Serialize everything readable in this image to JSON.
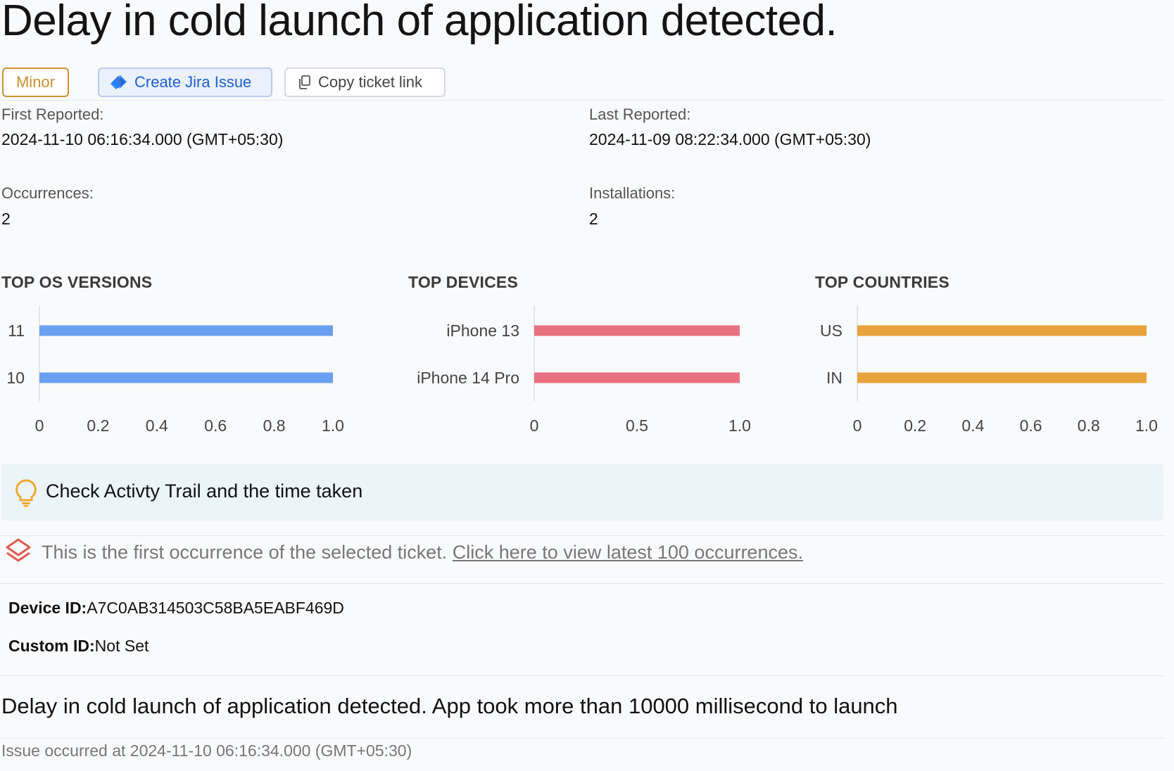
{
  "issue": {
    "title": "Delay in cold launch of application detected.",
    "severity_label": "Minor",
    "jira_button_label": "Create Jira Issue",
    "copy_button_label": "Copy ticket link"
  },
  "stats": {
    "first_reported_label": "First Reported:",
    "first_reported_value": "2024-11-10 06:16:34.000 (GMT+05:30)",
    "last_reported_label": "Last Reported:",
    "last_reported_value": "2024-11-09 08:22:34.000 (GMT+05:30)",
    "occurrences_label": "Occurrences:",
    "occurrences_value": "2",
    "installations_label": "Installations:",
    "installations_value": "2"
  },
  "chart_data": [
    {
      "type": "bar",
      "orientation": "horizontal",
      "title": "TOP OS VERSIONS",
      "categories": [
        "11",
        "10"
      ],
      "values": [
        1.0,
        1.0
      ],
      "xlim": [
        0,
        1.0
      ],
      "xticks": [
        "0",
        "0.2",
        "0.4",
        "0.6",
        "0.8",
        "1.0"
      ],
      "color": "#6b9ff0"
    },
    {
      "type": "bar",
      "orientation": "horizontal",
      "title": "TOP DEVICES",
      "categories": [
        "iPhone 13",
        "iPhone 14 Pro"
      ],
      "values": [
        1.0,
        1.0
      ],
      "xlim": [
        0,
        1.0
      ],
      "xticks": [
        "0",
        "0.5",
        "1.0"
      ],
      "color": "#e8707f"
    },
    {
      "type": "bar",
      "orientation": "horizontal",
      "title": "TOP COUNTRIES",
      "categories": [
        "US",
        "IN"
      ],
      "values": [
        1.0,
        1.0
      ],
      "xlim": [
        0,
        1.0
      ],
      "xticks": [
        "0",
        "0.2",
        "0.4",
        "0.6",
        "0.8",
        "1.0"
      ],
      "color": "#e9a33b"
    }
  ],
  "tip": {
    "text": "Check Activty Trail and the time taken",
    "icon": "lightbulb-icon",
    "color": "#f0a92e"
  },
  "occurrence": {
    "text": "This is the first occurrence of the selected ticket.",
    "link_text": "Click here to view latest 100 occurrences.",
    "icon": "layers-icon",
    "color": "#e05a52"
  },
  "identifiers": {
    "device_label": "Device ID:",
    "device_value": "A7C0AB314503C58BA5EABF469D",
    "custom_label": "Custom ID:",
    "custom_value": "Not Set"
  },
  "details": {
    "description": "Delay in cold launch of application detected. App took more than 10000 millisecond to launch",
    "occurred_at": "Issue occurred at 2024-11-10 06:16:34.000 (GMT+05:30)"
  }
}
